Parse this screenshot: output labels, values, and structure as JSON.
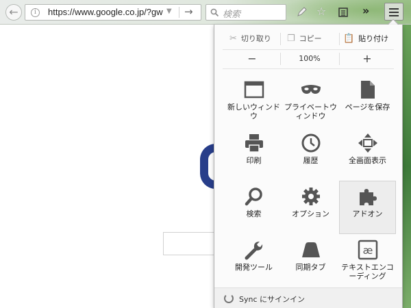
{
  "toolbar": {
    "url": "https://www.google.co.jp/?gw",
    "search_placeholder": "検索",
    "back_glyph": "←",
    "go_glyph": "→",
    "star_glyph": "☆",
    "overflow_glyph": "»"
  },
  "menu": {
    "edit": {
      "cut": "切り取り",
      "copy": "コピー",
      "paste": "貼り付け"
    },
    "zoom": {
      "minus": "−",
      "level": "100%",
      "plus": "+"
    },
    "items": [
      {
        "label": "新しいウィンドウ",
        "icon": "new-window-icon"
      },
      {
        "label": "プライベートウィンドウ",
        "icon": "private-mask-icon"
      },
      {
        "label": "ページを保存",
        "icon": "save-page-icon"
      },
      {
        "label": "印刷",
        "icon": "printer-icon"
      },
      {
        "label": "履歴",
        "icon": "clock-icon"
      },
      {
        "label": "全画面表示",
        "icon": "fullscreen-icon"
      },
      {
        "label": "検索",
        "icon": "magnifier-icon"
      },
      {
        "label": "オプション",
        "icon": "gear-icon"
      },
      {
        "label": "アドオン",
        "icon": "puzzle-icon"
      },
      {
        "label": "開発ツール",
        "icon": "wrench-icon"
      },
      {
        "label": "同期タブ",
        "icon": "synced-tabs-icon"
      },
      {
        "label": "テキストエンコーディング",
        "icon": "text-encoding-icon"
      }
    ],
    "selected_item": "アドオン",
    "sync_label": "Sync にサインイン"
  },
  "colors": {
    "icon": "#555555",
    "google_blue": "#283e8a"
  }
}
